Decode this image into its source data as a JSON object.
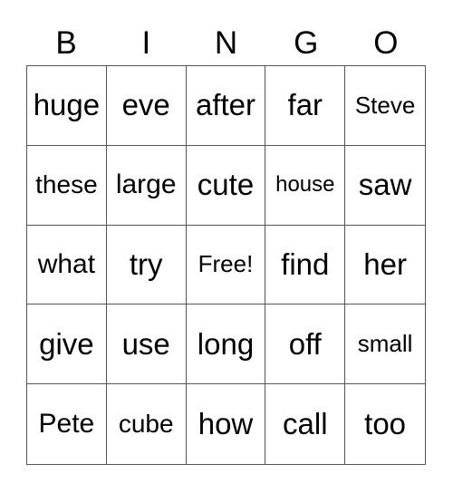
{
  "header": [
    "B",
    "I",
    "N",
    "G",
    "O"
  ],
  "rows": [
    [
      "huge",
      "eve",
      "after",
      "far",
      "Steve"
    ],
    [
      "these",
      "large",
      "cute",
      "house",
      "saw"
    ],
    [
      "what",
      "try",
      "Free!",
      "find",
      "her"
    ],
    [
      "give",
      "use",
      "long",
      "off",
      "small"
    ],
    [
      "Pete",
      "cube",
      "how",
      "call",
      "too"
    ]
  ]
}
